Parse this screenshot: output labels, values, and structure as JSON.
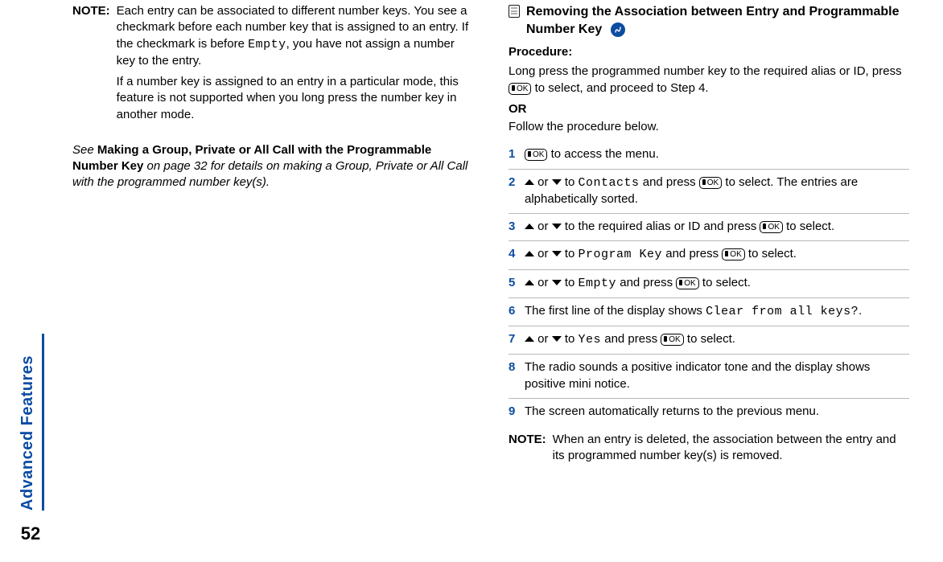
{
  "rail": {
    "label": "Advanced Features",
    "page_number": "52"
  },
  "left": {
    "note_label": "NOTE:",
    "note_p1a": "Each entry can be associated to different number keys. You see a checkmark before each number key that is assigned to an entry. If the checkmark is before ",
    "note_empty": "Empty",
    "note_p1b": ", you have not assign a number key to the entry.",
    "note_p2": "If a number key is assigned to an entry in a particular mode, this feature is not supported when you long press the number key in another mode.",
    "see_a": "See ",
    "see_bold": "Making a Group, Private or All Call with the Programmable Number Key",
    "see_b": " on page 32 for details on making a Group, Private or All Call with the programmed number key(s)."
  },
  "right": {
    "heading": "Removing the Association between Entry and Programmable Number Key",
    "procedure_label": "Procedure:",
    "intro_a": "Long press the programmed number key to the required alias or ID, press ",
    "intro_b": " to select, and proceed to Step 4.",
    "or_label": "OR",
    "follow": "Follow the procedure below.",
    "steps": {
      "s1": " to access the menu.",
      "s2a": " or ",
      "s2b": " to ",
      "s2_contacts": "Contacts",
      "s2c": " and press ",
      "s2d": " to select. The entries are alphabetically sorted.",
      "s3a": " or ",
      "s3b": " to the required alias or ID and press ",
      "s3c": " to select.",
      "s4a": " or ",
      "s4b": " to ",
      "s4_pk": "Program Key",
      "s4c": " and press ",
      "s4d": " to select.",
      "s5a": " or ",
      "s5b": " to ",
      "s5_empty": "Empty",
      "s5c": " and press ",
      "s5d": " to select.",
      "s6a": "The first line of the display shows ",
      "s6_clear": "Clear from all keys?",
      "s6b": ".",
      "s7a": " or ",
      "s7b": " to ",
      "s7_yes": "Yes",
      "s7c": " and press ",
      "s7d": " to select.",
      "s8": "The radio sounds a positive indicator tone and the display shows positive mini notice.",
      "s9": "The screen automatically returns to the previous menu."
    },
    "note_label": "NOTE:",
    "note_text": "When an entry is deleted, the association between the entry and its programmed number key(s) is removed.",
    "nums": {
      "n1": "1",
      "n2": "2",
      "n3": "3",
      "n4": "4",
      "n5": "5",
      "n6": "6",
      "n7": "7",
      "n8": "8",
      "n9": "9"
    }
  }
}
